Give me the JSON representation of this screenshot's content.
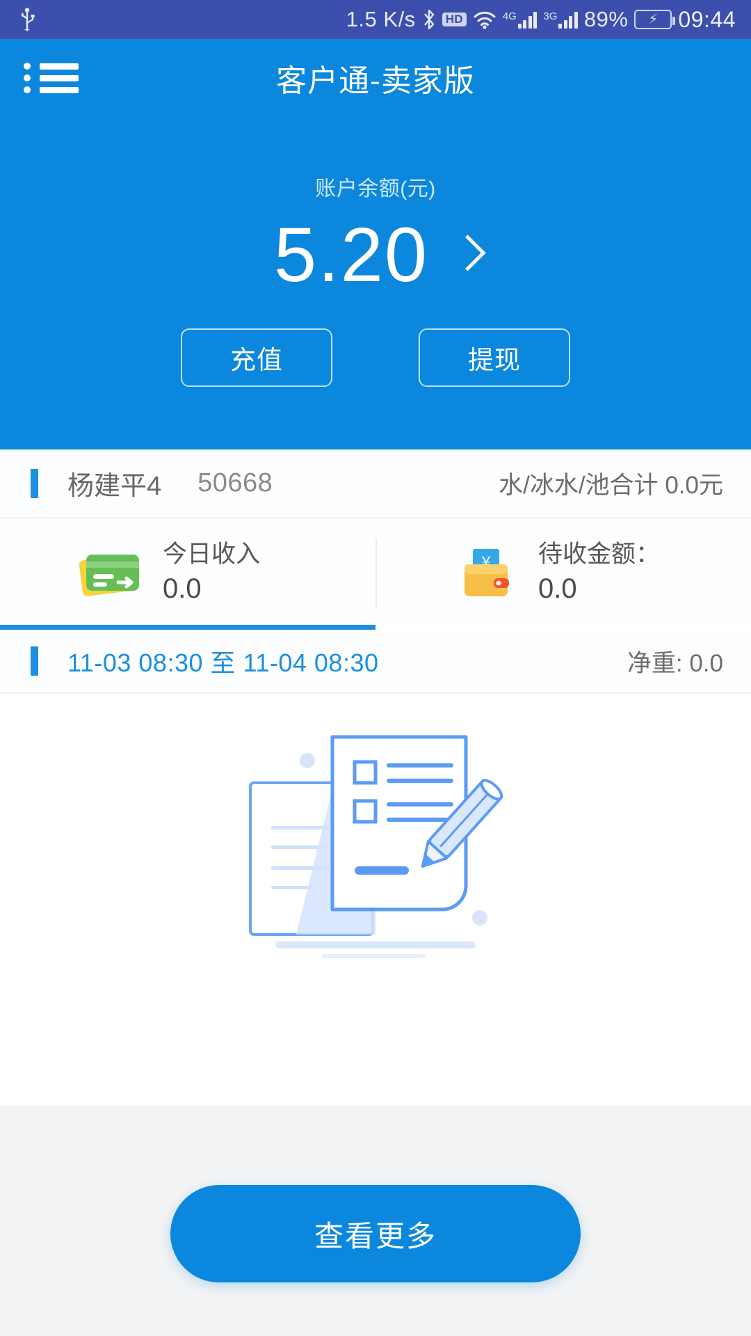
{
  "status_bar": {
    "usb_icon": "usb-icon",
    "network_speed": "1.5 K/s",
    "bluetooth_icon": "bluetooth-icon",
    "hd_badge": "HD",
    "wifi_icon": "wifi-icon",
    "sim1_label": "4G",
    "sim2_label": "3G",
    "battery_percent": "89%",
    "battery_icon": "battery-charging-icon",
    "time": "09:44"
  },
  "app_bar": {
    "menu_icon": "list-menu-icon",
    "title": "客户通-卖家版"
  },
  "hero": {
    "balance_label": "账户余额(元)",
    "balance_amount": "5.20",
    "chevron_icon": "chevron-right-icon",
    "recharge_label": "充值",
    "withdraw_label": "提现"
  },
  "account_row": {
    "name": "杨建平4",
    "code": "50668",
    "summary": "水/冰水/池合计 0.0元"
  },
  "stats": [
    {
      "icon": "green-card-icon",
      "label": "今日收入",
      "value": "0.0",
      "selected": true
    },
    {
      "icon": "yellow-wallet-icon",
      "label": "待收金额：",
      "value": "0.0",
      "selected": false
    }
  ],
  "date_row": {
    "range": "11-03 08:30 至 11-04 08:30",
    "net_weight": "净重: 0.0"
  },
  "empty_state": {
    "illustration": "document-checklist-pencil-illustration"
  },
  "footer": {
    "more_label": "查看更多"
  },
  "colors": {
    "status_bar": "#3c4fad",
    "brand_blue": "#0b87dd",
    "accent_blue": "#1b8fe0",
    "footer_bg": "#f2f3f4",
    "illustration_blue": "#5b9bf5"
  }
}
